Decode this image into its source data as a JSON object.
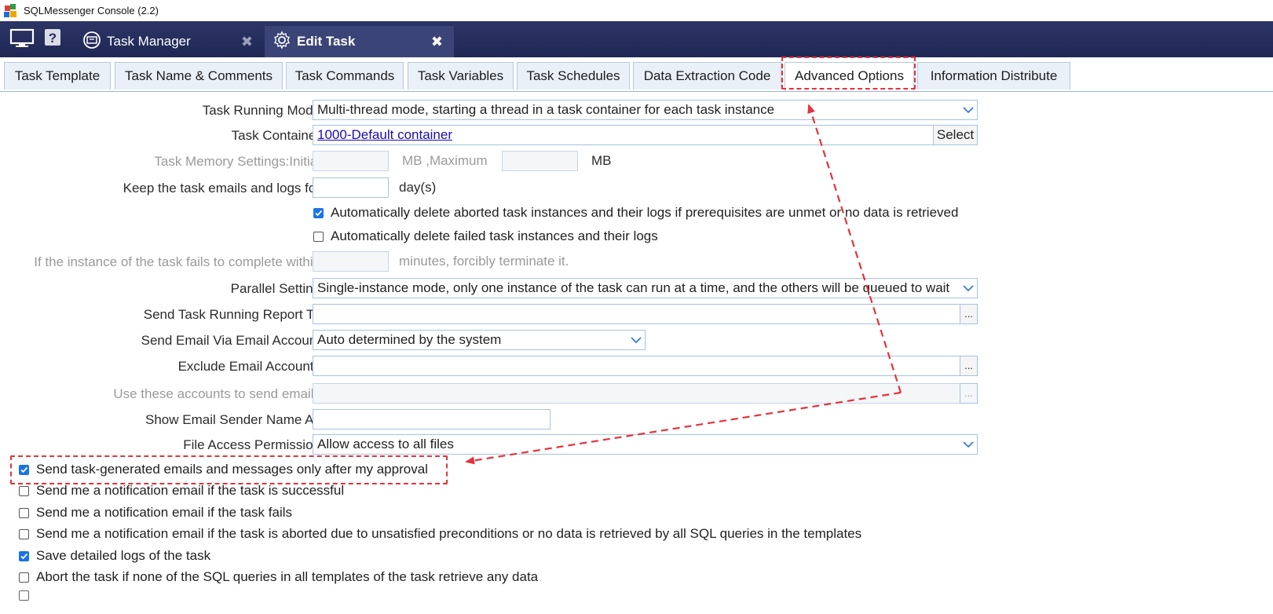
{
  "window": {
    "title": "SQLMessenger Console (2.2)"
  },
  "top_tabs": [
    {
      "label": "Task Manager",
      "close": "✖"
    },
    {
      "label": "Edit Task",
      "close": "✖"
    }
  ],
  "sub_tabs": [
    "Task Template",
    "Task Name & Comments",
    "Task Commands",
    "Task Variables",
    "Task Schedules",
    "Data Extraction Code",
    "Advanced Options",
    "Information Distribute"
  ],
  "active_sub_tab": "Advanced Options",
  "form": {
    "running_mode": {
      "label": "Task Running Mode",
      "value": "Multi-thread mode, starting a thread in a task container for each task instance"
    },
    "container": {
      "label": "Task Container",
      "value": "1000-Default container",
      "button": "Select"
    },
    "memory": {
      "label": "Task Memory Settings:Initial",
      "initial": "",
      "mid": "MB ,Maximum",
      "maximum": "",
      "unit": "MB"
    },
    "keep_logs": {
      "label": "Keep the task emails and logs for",
      "value": "",
      "unit": "day(s)"
    },
    "auto_delete_aborted": {
      "label": "Automatically delete aborted task instances and their logs if prerequisites are unmet or no data is retrieved",
      "checked": true
    },
    "auto_delete_failed": {
      "label": "Automatically delete failed task instances and their logs",
      "checked": false
    },
    "timeout": {
      "label": "If the instance of the task fails to complete within",
      "value": "",
      "unit": "minutes, forcibly terminate it."
    },
    "parallel": {
      "label": "Parallel Setting",
      "value": "Single-instance mode, only one instance of the task can run at a time, and the others will be queued to wait"
    },
    "report_to": {
      "label": "Send Task Running Report To",
      "value": "",
      "button": "..."
    },
    "email_account": {
      "label": "Send Email Via Email Account",
      "value": "Auto determined by the system"
    },
    "exclude_accounts": {
      "label": "Exclude Email Accounts",
      "value": "",
      "button": "..."
    },
    "use_accounts": {
      "label": "Use these accounts to send emails",
      "value": "",
      "button": "..."
    },
    "sender_name": {
      "label": "Show Email Sender Name As",
      "value": ""
    },
    "file_access": {
      "label": "File Access Permission",
      "value": "Allow access to all files"
    }
  },
  "checkboxes": [
    {
      "label": "Send task-generated emails and messages only after my approval",
      "checked": true
    },
    {
      "label": "Send me a notification email if the task is successful",
      "checked": false
    },
    {
      "label": "Send me a notification email if the task fails",
      "checked": false
    },
    {
      "label": "Send me a notification email if the task is aborted due to unsatisfied preconditions or no data is retrieved by all SQL queries in the templates",
      "checked": false
    },
    {
      "label": "Save detailed logs of the task",
      "checked": true
    },
    {
      "label": "Abort the task if none of the SQL queries in all templates of the task retrieve any data",
      "checked": false
    }
  ],
  "colors": {
    "annotation": "#e5323b",
    "accent": "#1a73e8",
    "header": "#242c5c"
  }
}
